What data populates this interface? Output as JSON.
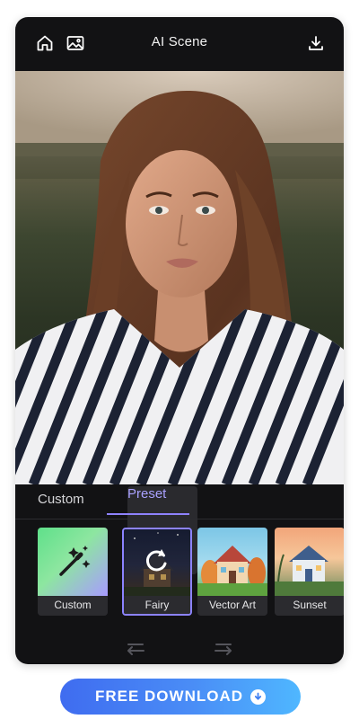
{
  "header": {
    "title": "AI Scene",
    "icons": [
      "home-icon",
      "gallery-icon",
      "download-icon"
    ]
  },
  "photo": {
    "subject": "portrait"
  },
  "tabs": [
    {
      "label": "Custom",
      "active": false
    },
    {
      "label": "Preset",
      "active": true
    }
  ],
  "presets": [
    {
      "label": "Custom",
      "icon": "magic-wand-icon",
      "selected": false
    },
    {
      "label": "Fairy",
      "icon": "refresh-icon",
      "selected": true
    },
    {
      "label": "Vector Art",
      "selected": false
    },
    {
      "label": "Sunset",
      "selected": false
    }
  ],
  "bottom_nav": {
    "icons": [
      "undo-icon",
      "redo-icon"
    ]
  },
  "download_button": {
    "label": "FREE DOWNLOAD",
    "icon": "download-circle-icon"
  },
  "colors": {
    "accent": "#8e82ff",
    "phone_bg": "#121214",
    "download_gradient_start": "#3f6cf0",
    "download_gradient_end": "#4fb7ff"
  }
}
